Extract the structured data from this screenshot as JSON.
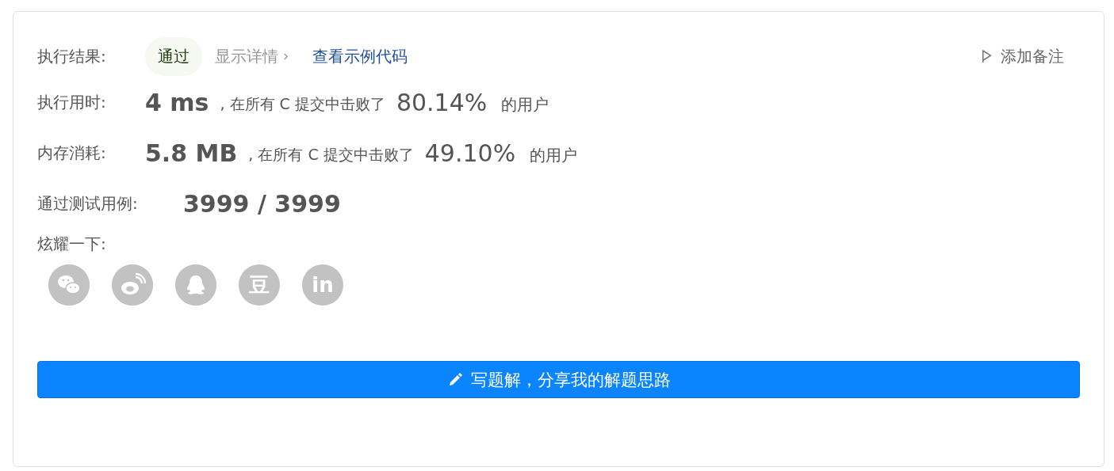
{
  "result": {
    "label": "执行结果:",
    "status": "通过",
    "details_link": "显示详情",
    "example_link": "查看示例代码",
    "note_button": "添加备注"
  },
  "stats": [
    {
      "label": "执行用时:",
      "value": "4 ms",
      "middle": ", 在所有 C 提交中击败了",
      "percent": "80.14%",
      "suffix": "的用户"
    },
    {
      "label": "内存消耗:",
      "value": "5.8 MB",
      "middle": ", 在所有 C 提交中击败了",
      "percent": "49.10%",
      "suffix": "的用户"
    }
  ],
  "tests": {
    "label": "通过测试用例:",
    "value": "3999 / 3999"
  },
  "share": {
    "label": "炫耀一下:",
    "items": [
      {
        "kind": "wechat"
      },
      {
        "kind": "weibo"
      },
      {
        "kind": "qq"
      },
      {
        "kind": "glyph",
        "glyph": "豆"
      },
      {
        "kind": "glyph",
        "glyph": "in"
      }
    ]
  },
  "write_button": "写题解，分享我的解题思路"
}
